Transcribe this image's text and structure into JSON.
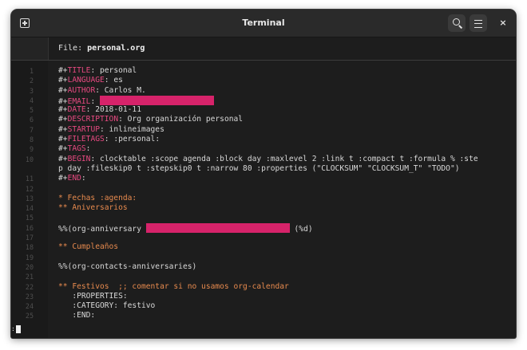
{
  "window": {
    "title": "Terminal",
    "icons": {
      "new_tab": "new-tab-icon",
      "search": "search-icon",
      "menu": "hamburger-menu-icon",
      "close": "close-icon"
    },
    "close_glyph": "×"
  },
  "header": {
    "prefix": "File: ",
    "filename": "personal.org"
  },
  "colors": {
    "keyword": "#e64980",
    "heading": "#e78a4e",
    "redaction": "#d6236a",
    "background": "#1d1d1d"
  },
  "lines": [
    {
      "n": "1",
      "segs": [
        {
          "c": "tx",
          "t": "#+"
        },
        {
          "c": "kw",
          "t": "TITLE"
        },
        {
          "c": "tx",
          "t": ": personal"
        }
      ]
    },
    {
      "n": "2",
      "segs": [
        {
          "c": "tx",
          "t": "#+"
        },
        {
          "c": "kw",
          "t": "LANGUAGE"
        },
        {
          "c": "tx",
          "t": ": es"
        }
      ]
    },
    {
      "n": "3",
      "segs": [
        {
          "c": "tx",
          "t": "#+"
        },
        {
          "c": "kw",
          "t": "AUTHOR"
        },
        {
          "c": "tx",
          "t": ": Carlos M."
        }
      ]
    },
    {
      "n": "4",
      "segs": [
        {
          "c": "tx",
          "t": "#+"
        },
        {
          "c": "kw",
          "t": "EMAIL"
        },
        {
          "c": "tx",
          "t": ": "
        },
        {
          "c": "redact",
          "w": 143
        }
      ]
    },
    {
      "n": "5",
      "segs": [
        {
          "c": "tx",
          "t": "#+"
        },
        {
          "c": "kw",
          "t": "DATE"
        },
        {
          "c": "tx",
          "t": ": 2018-01-11"
        }
      ]
    },
    {
      "n": "6",
      "segs": [
        {
          "c": "tx",
          "t": "#+"
        },
        {
          "c": "kw",
          "t": "DESCRIPTION"
        },
        {
          "c": "tx",
          "t": ": Org organización personal"
        }
      ]
    },
    {
      "n": "7",
      "segs": [
        {
          "c": "tx",
          "t": "#+"
        },
        {
          "c": "kw",
          "t": "STARTUP"
        },
        {
          "c": "tx",
          "t": ": inlineimages"
        }
      ]
    },
    {
      "n": "8",
      "segs": [
        {
          "c": "tx",
          "t": "#+"
        },
        {
          "c": "kw",
          "t": "FILETAGS"
        },
        {
          "c": "tx",
          "t": ": :personal:"
        }
      ]
    },
    {
      "n": "9",
      "segs": [
        {
          "c": "tx",
          "t": "#+"
        },
        {
          "c": "kw",
          "t": "TAGS"
        },
        {
          "c": "tx",
          "t": ":"
        }
      ]
    },
    {
      "n": "10",
      "segs": [
        {
          "c": "tx",
          "t": "#+"
        },
        {
          "c": "kw",
          "t": "BEGIN"
        },
        {
          "c": "tx",
          "t": ": clocktable :scope agenda :block day :maxlevel 2 :link t :compact t :formula % :ste"
        }
      ]
    },
    {
      "n": "",
      "segs": [
        {
          "c": "tx",
          "t": "p day :fileskip0 t :stepskip0 t :narrow 80 :properties (\"CLOCKSUM\" \"CLOCKSUM_T\" \"TODO\")"
        }
      ]
    },
    {
      "n": "11",
      "segs": [
        {
          "c": "tx",
          "t": "#+"
        },
        {
          "c": "kw",
          "t": "END"
        },
        {
          "c": "tx",
          "t": ":"
        }
      ]
    },
    {
      "n": "12",
      "segs": []
    },
    {
      "n": "13",
      "segs": [
        {
          "c": "hd",
          "t": "* Fechas :agenda:"
        }
      ]
    },
    {
      "n": "14",
      "segs": [
        {
          "c": "hd",
          "t": "** Aniversarios"
        }
      ]
    },
    {
      "n": "15",
      "segs": []
    },
    {
      "n": "16",
      "segs": [
        {
          "c": "tx",
          "t": "%%(org-anniversary "
        },
        {
          "c": "redact",
          "w": 180
        },
        {
          "c": "tx",
          "t": " (%d)"
        }
      ]
    },
    {
      "n": "17",
      "segs": []
    },
    {
      "n": "18",
      "segs": [
        {
          "c": "hd",
          "t": "** Cumpleaños"
        }
      ]
    },
    {
      "n": "19",
      "segs": []
    },
    {
      "n": "20",
      "segs": [
        {
          "c": "tx",
          "t": "%%(org-contacts-anniversaries)"
        }
      ]
    },
    {
      "n": "21",
      "segs": []
    },
    {
      "n": "22",
      "segs": [
        {
          "c": "hd",
          "t": "** Festivos  ;; comentar si no usamos org-calendar"
        }
      ]
    },
    {
      "n": "23",
      "segs": [
        {
          "c": "tx",
          "t": "   :PROPERTIES:"
        }
      ]
    },
    {
      "n": "24",
      "segs": [
        {
          "c": "tx",
          "t": "   :CATEGORY: festivo"
        }
      ]
    },
    {
      "n": "25",
      "segs": [
        {
          "c": "tx",
          "t": "   :END:"
        }
      ]
    }
  ],
  "prompt": {
    "text": ":"
  }
}
